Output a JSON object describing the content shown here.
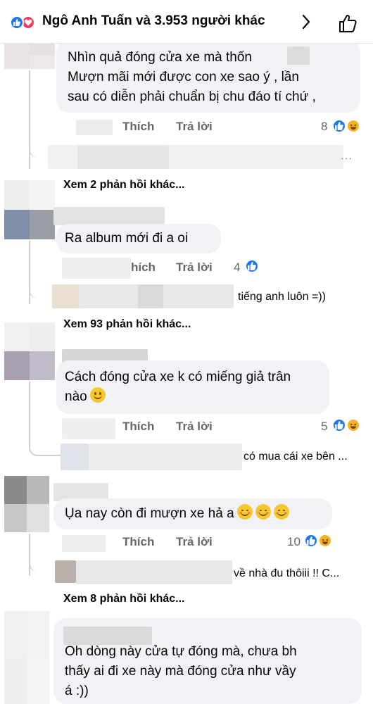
{
  "header": {
    "title": "Ngô Anh Tuấn và 3.953 người khác"
  },
  "labels": {
    "like": "Thích",
    "reply": "Trả lời"
  },
  "comments": [
    {
      "text_lines": [
        "Nhìn quả đóng cửa xe mà thốn",
        "Mượn mãi mới được con xe sao ý , lần",
        "sau có diễn phải chuẩn bị chu đáo tí chứ ,"
      ],
      "reaction_count": "8",
      "like_label": "Thích",
      "reply_label": "Trả lời",
      "more_replies": "Xem 2 phản hồi khác..."
    },
    {
      "text_lines": [
        "Ra album mới đi a oi"
      ],
      "reaction_count": "4",
      "like_label": "hích",
      "reply_label": "Trả lời",
      "reply_preview": "tiếng anh luôn =))",
      "more_replies": "Xem 93 phản hồi khác..."
    },
    {
      "text_lines": [
        "Cách đóng cửa xe k có miếng giả trân",
        "nào"
      ],
      "reaction_count": "5",
      "like_label": "Thích",
      "reply_label": "Trả lời",
      "reply_preview": "có mua cái xe bên ..."
    },
    {
      "text_lines": [
        "Ụa nay còn đi mượn xe hả a"
      ],
      "reaction_count": "10",
      "like_label": "Thích",
      "reply_label": "Trả lời",
      "reply_preview": "về nhà đu thôiii !! C...",
      "more_replies": "Xem 8 phản hồi khác..."
    },
    {
      "text_lines": [
        "Oh dòng này cửa tự đóng mà, chưa bh",
        "thấy ai đi xe này mà đóng cửa như vầy",
        "á :))"
      ]
    }
  ],
  "icons": [
    "like-reaction-icon",
    "love-reaction-icon",
    "haha-reaction-icon",
    "chevron-right-icon",
    "thumbs-up-icon",
    "smile-emoji",
    "blush-emoji"
  ],
  "colors": {
    "accent": "#1877f2",
    "love": "#f33e58",
    "haha": "#f7b125",
    "bubble": "#f0f2f5",
    "meta": "#65676b"
  }
}
